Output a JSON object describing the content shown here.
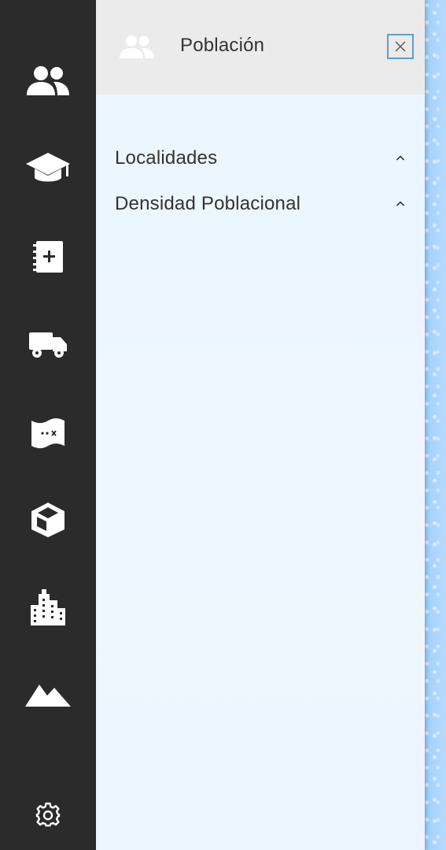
{
  "panel": {
    "title": "Población",
    "header_icon": "users-icon",
    "close_icon": "close-icon",
    "items": [
      {
        "label": "Localidades",
        "icon": "chevron-up-icon"
      },
      {
        "label": "Densidad Poblacional",
        "icon": "chevron-up-icon"
      }
    ]
  },
  "rail": {
    "items": [
      {
        "icon": "users-icon"
      },
      {
        "icon": "graduation-cap-icon"
      },
      {
        "icon": "medical-book-icon"
      },
      {
        "icon": "truck-icon"
      },
      {
        "icon": "map-icon"
      },
      {
        "icon": "cube-icon"
      },
      {
        "icon": "buildings-icon"
      },
      {
        "icon": "mountain-icon"
      },
      {
        "icon": "gear-icon"
      }
    ]
  },
  "colors": {
    "rail_bg": "#2b2b2b",
    "panel_bg": "#eef7ff",
    "header_bg": "#ebebeb",
    "accent": "#5c9ed3",
    "text": "#333333"
  }
}
